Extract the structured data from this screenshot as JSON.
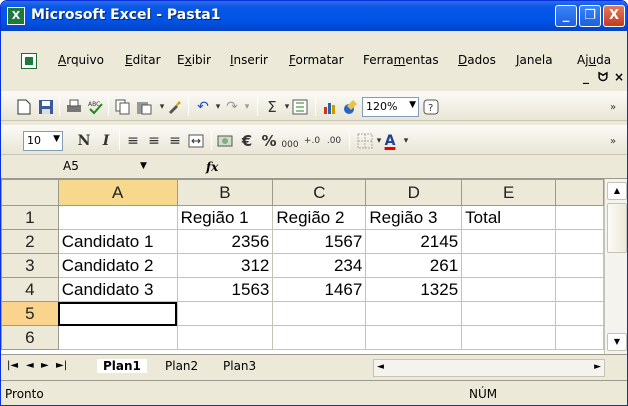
{
  "window": {
    "title": "Microsoft Excel - Pasta1",
    "minimize": "_",
    "restore": "❐",
    "close": "X"
  },
  "menu": {
    "items": [
      {
        "pre": "",
        "u": "A",
        "post": "rquivo"
      },
      {
        "pre": "",
        "u": "E",
        "post": "ditar"
      },
      {
        "pre": "E",
        "u": "x",
        "post": "ibir"
      },
      {
        "pre": "",
        "u": "I",
        "post": "nserir"
      },
      {
        "pre": "",
        "u": "F",
        "post": "ormatar"
      },
      {
        "pre": "Ferra",
        "u": "m",
        "post": "entas"
      },
      {
        "pre": "",
        "u": "D",
        "post": "ados"
      },
      {
        "pre": "",
        "u": "J",
        "post": "anela"
      },
      {
        "pre": "Aj",
        "u": "u",
        "post": "da"
      }
    ],
    "mdi_min": "_",
    "mdi_restore": "ᗢ",
    "mdi_close": "×"
  },
  "toolbar": {
    "zoom": "120%",
    "font_size": "10",
    "euro": "€",
    "percent": "%",
    "thousands": "000",
    "sigma": "Σ"
  },
  "formula_bar": {
    "name_box": "A5",
    "fx": "fx",
    "content": ""
  },
  "sheet": {
    "columns": [
      "A",
      "B",
      "C",
      "D",
      "E"
    ],
    "rows": [
      {
        "n": "1",
        "cells": [
          "",
          "Região 1",
          "Região 2",
          "Região 3",
          "Total"
        ]
      },
      {
        "n": "2",
        "cells": [
          "Candidato 1",
          "2356",
          "1567",
          "2145",
          ""
        ]
      },
      {
        "n": "3",
        "cells": [
          "Candidato 2",
          "312",
          "234",
          "261",
          ""
        ]
      },
      {
        "n": "4",
        "cells": [
          "Candidato 3",
          "1563",
          "1467",
          "1325",
          ""
        ]
      },
      {
        "n": "5",
        "cells": [
          "",
          "",
          "",
          "",
          ""
        ]
      },
      {
        "n": "6",
        "cells": [
          "",
          "",
          "",
          "",
          ""
        ]
      }
    ],
    "active_cell": "A5"
  },
  "tabs": [
    "Plan1",
    "Plan2",
    "Plan3"
  ],
  "active_tab": "Plan1",
  "status": {
    "left": "Pronto",
    "num": "NÚM"
  }
}
